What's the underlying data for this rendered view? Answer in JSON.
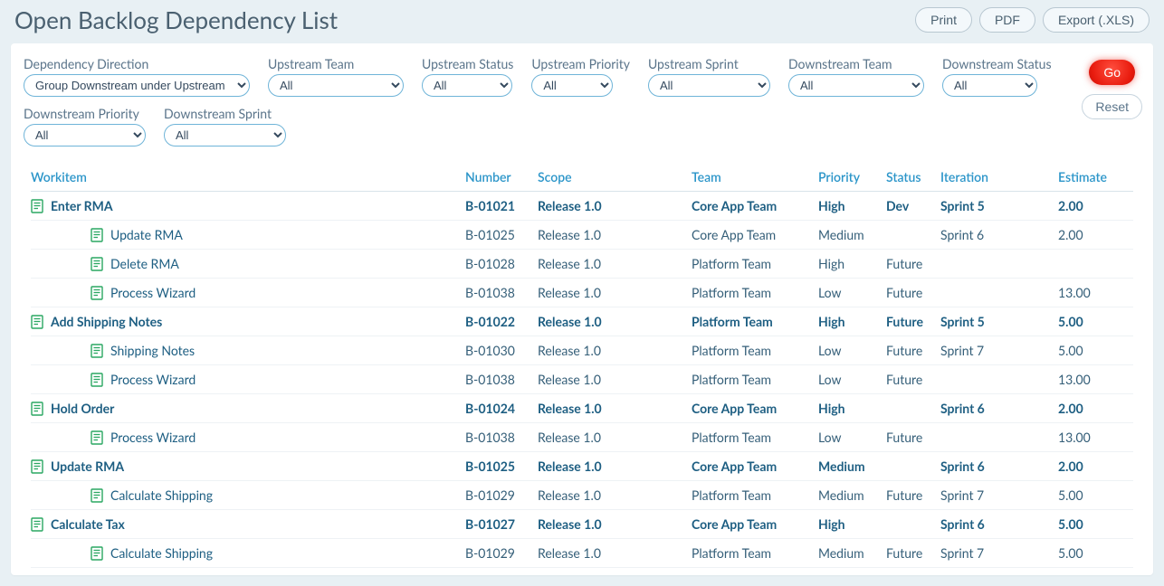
{
  "page_title": "Open Backlog Dependency List",
  "header_actions": {
    "print": "Print",
    "pdf": "PDF",
    "export": "Export (.XLS)"
  },
  "filters": [
    {
      "key": "dependency_direction",
      "label": "Dependency Direction",
      "value": "Group Downstream under Upstream",
      "w": "w1"
    },
    {
      "key": "upstream_team",
      "label": "Upstream Team",
      "value": "All",
      "w": "w2"
    },
    {
      "key": "upstream_status",
      "label": "Upstream Status",
      "value": "All",
      "w": "w3"
    },
    {
      "key": "upstream_priority",
      "label": "Upstream Priority",
      "value": "All",
      "w": "w4"
    },
    {
      "key": "upstream_sprint",
      "label": "Upstream Sprint",
      "value": "All",
      "w": "w5"
    },
    {
      "key": "downstream_team",
      "label": "Downstream Team",
      "value": "All",
      "w": "w2"
    },
    {
      "key": "downstream_status",
      "label": "Downstream Status",
      "value": "All",
      "w": "w6"
    },
    {
      "key": "downstream_priority",
      "label": "Downstream Priority",
      "value": "All",
      "w": "w5"
    },
    {
      "key": "downstream_sprint",
      "label": "Downstream Sprint",
      "value": "All",
      "w": "w5"
    }
  ],
  "buttons": {
    "go": "Go",
    "reset": "Reset"
  },
  "columns": {
    "workitem": "Workitem",
    "number": "Number",
    "scope": "Scope",
    "team": "Team",
    "priority": "Priority",
    "status": "Status",
    "iteration": "Iteration",
    "estimate": "Estimate"
  },
  "rows": [
    {
      "type": "parent",
      "workitem": "Enter RMA",
      "number": "B-01021",
      "scope": "Release 1.0",
      "team": "Core App Team",
      "priority": "High",
      "status": "Dev",
      "iteration": "Sprint 5",
      "estimate": "2.00"
    },
    {
      "type": "child",
      "workitem": "Update RMA",
      "number": "B-01025",
      "scope": "Release 1.0",
      "team": "Core App Team",
      "priority": "Medium",
      "status": "",
      "iteration": "Sprint 6",
      "estimate": "2.00"
    },
    {
      "type": "child",
      "workitem": "Delete RMA",
      "number": "B-01028",
      "scope": "Release 1.0",
      "team": "Platform Team",
      "priority": "High",
      "status": "Future",
      "iteration": "",
      "estimate": ""
    },
    {
      "type": "child",
      "workitem": "Process Wizard",
      "number": "B-01038",
      "scope": "Release 1.0",
      "team": "Platform Team",
      "priority": "Low",
      "status": "Future",
      "iteration": "",
      "estimate": "13.00"
    },
    {
      "type": "parent",
      "workitem": "Add Shipping Notes",
      "number": "B-01022",
      "scope": "Release 1.0",
      "team": "Platform Team",
      "priority": "High",
      "status": "Future",
      "iteration": "Sprint 5",
      "estimate": "5.00"
    },
    {
      "type": "child",
      "workitem": "Shipping Notes",
      "number": "B-01030",
      "scope": "Release 1.0",
      "team": "Platform Team",
      "priority": "Low",
      "status": "Future",
      "iteration": "Sprint 7",
      "estimate": "5.00"
    },
    {
      "type": "child",
      "workitem": "Process Wizard",
      "number": "B-01038",
      "scope": "Release 1.0",
      "team": "Platform Team",
      "priority": "Low",
      "status": "Future",
      "iteration": "",
      "estimate": "13.00"
    },
    {
      "type": "parent",
      "workitem": "Hold Order",
      "number": "B-01024",
      "scope": "Release 1.0",
      "team": "Core App Team",
      "priority": "High",
      "status": "",
      "iteration": "Sprint 6",
      "estimate": "2.00"
    },
    {
      "type": "child",
      "workitem": "Process Wizard",
      "number": "B-01038",
      "scope": "Release 1.0",
      "team": "Platform Team",
      "priority": "Low",
      "status": "Future",
      "iteration": "",
      "estimate": "13.00"
    },
    {
      "type": "parent",
      "workitem": "Update RMA",
      "number": "B-01025",
      "scope": "Release 1.0",
      "team": "Core App Team",
      "priority": "Medium",
      "status": "",
      "iteration": "Sprint 6",
      "estimate": "2.00"
    },
    {
      "type": "child",
      "workitem": "Calculate Shipping",
      "number": "B-01029",
      "scope": "Release 1.0",
      "team": "Platform Team",
      "priority": "Medium",
      "status": "Future",
      "iteration": "Sprint 7",
      "estimate": "5.00"
    },
    {
      "type": "parent",
      "workitem": "Calculate Tax",
      "number": "B-01027",
      "scope": "Release 1.0",
      "team": "Core App Team",
      "priority": "High",
      "status": "",
      "iteration": "Sprint 6",
      "estimate": "5.00"
    },
    {
      "type": "child",
      "workitem": "Calculate Shipping",
      "number": "B-01029",
      "scope": "Release 1.0",
      "team": "Platform Team",
      "priority": "Medium",
      "status": "Future",
      "iteration": "Sprint 7",
      "estimate": "5.00"
    }
  ]
}
